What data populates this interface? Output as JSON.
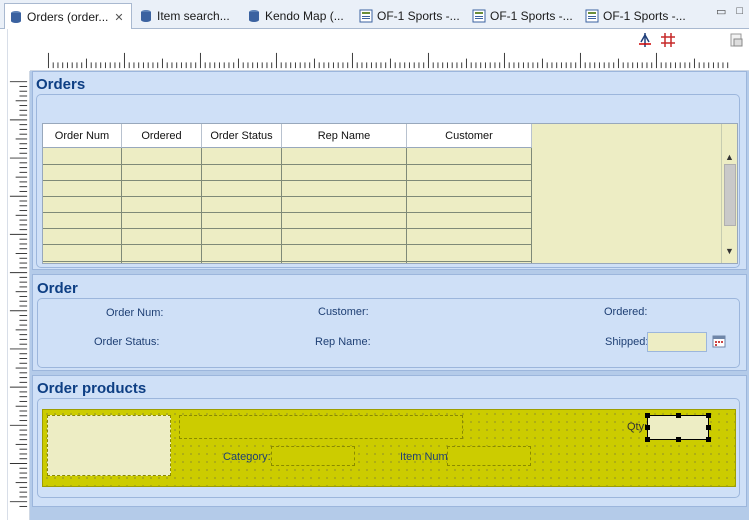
{
  "tabs": [
    {
      "label": "Orders (order...",
      "active": true,
      "icon": "database-icon"
    },
    {
      "label": "Item search...",
      "active": false,
      "icon": "database-icon"
    },
    {
      "label": "Kendo Map (...",
      "active": false,
      "icon": "database-icon"
    },
    {
      "label": "OF-1 Sports -...",
      "active": false,
      "icon": "form-icon"
    },
    {
      "label": "OF-1 Sports -...",
      "active": false,
      "icon": "form-icon"
    },
    {
      "label": "OF-1 Sports -...",
      "active": false,
      "icon": "form-icon"
    }
  ],
  "orders_frame": {
    "title": "Orders",
    "columns": [
      "Order Num",
      "Ordered",
      "Order Status",
      "Rep Name",
      "Customer"
    ]
  },
  "order_frame": {
    "title": "Order",
    "labels": {
      "order_num": "Order Num:",
      "customer": "Customer:",
      "ordered": "Ordered:",
      "order_status": "Order Status:",
      "rep_name": "Rep Name:",
      "shipped": "Shipped:"
    }
  },
  "products_frame": {
    "title": "Order products",
    "labels": {
      "qty": "Qty:",
      "category": "Category:",
      "item_num": "Item Num:"
    }
  },
  "colors": {
    "surface": "#b4cbe9",
    "frame": "#cfe0f7",
    "field": "#ededc4",
    "olive": "#cccc00",
    "title": "#0e3f84"
  }
}
